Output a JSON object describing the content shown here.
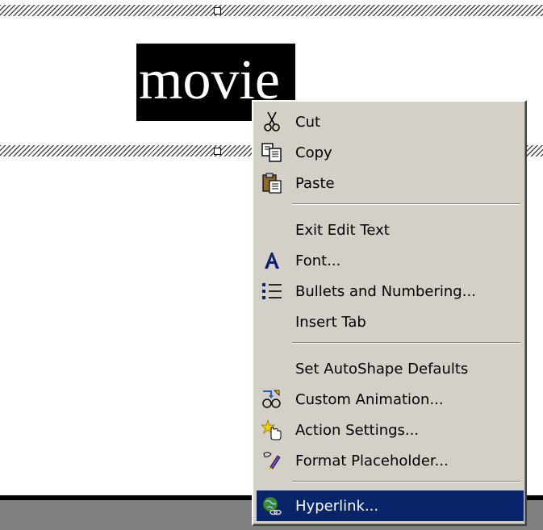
{
  "slide": {
    "selected_text": "movie"
  },
  "context_menu": {
    "cut": "Cut",
    "copy": "Copy",
    "paste": "Paste",
    "exit_edit_text": "Exit Edit Text",
    "font": "Font...",
    "bullets_and_numbering": "Bullets and Numbering...",
    "insert_tab": "Insert Tab",
    "set_autoshape_defaults": "Set AutoShape Defaults",
    "custom_animation": "Custom Animation...",
    "action_settings": "Action Settings...",
    "format_placeholder": "Format Placeholder...",
    "hyperlink": "Hyperlink...",
    "highlighted_item": "Hyperlink..."
  },
  "icons": {
    "cut": "scissors-icon",
    "copy": "copy-icon",
    "paste": "paste-icon",
    "font": "font-icon",
    "bullets": "bullets-icon",
    "custom_animation": "custom-animation-icon",
    "action_settings": "action-settings-icon",
    "format_placeholder": "format-placeholder-icon",
    "hyperlink": "hyperlink-icon"
  },
  "colors": {
    "menu_background": "#d4d0c8",
    "highlight": "#0a246a",
    "highlight_text": "#ffffff"
  }
}
